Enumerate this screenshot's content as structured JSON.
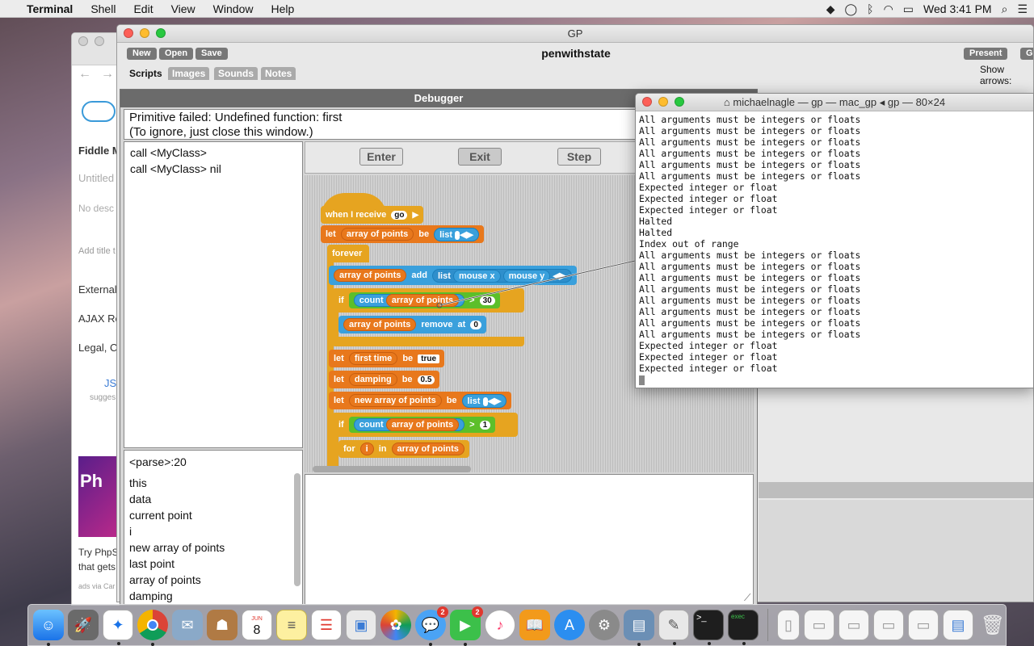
{
  "menubar": {
    "app": "Terminal",
    "items": [
      "Shell",
      "Edit",
      "View",
      "Window",
      "Help"
    ],
    "clock": "Wed 3:41 PM"
  },
  "safari": {
    "rows": [
      "Fiddle M",
      "Untitled",
      "No desc",
      "Add title t",
      "External",
      "AJAX Re",
      "Legal, Cr",
      "JS",
      "sugges",
      "Try PhpS",
      "that gets",
      "ads via Car"
    ],
    "ad_text": "Ph"
  },
  "gp": {
    "window_title": "GP",
    "project": "penwithstate",
    "buttons": {
      "new": "New",
      "open": "Open",
      "save": "Save",
      "present": "Present",
      "go": "G"
    },
    "tabs": [
      "Scripts",
      "Images",
      "Sounds",
      "Notes"
    ],
    "show_arrows": "Show arrows:"
  },
  "debugger": {
    "title": "Debugger",
    "message": [
      "Primitive failed: Undefined function: first",
      "(To ignore, just close this window.)"
    ],
    "stack": [
      "call <MyClass>",
      "call <MyClass> nil"
    ],
    "buttons": {
      "enter": "Enter",
      "exit": "Exit",
      "step": "Step"
    },
    "location": "<parse>:20",
    "vars": [
      "this",
      "data",
      "current point",
      "i",
      "new array of points",
      "last point",
      "array of points",
      "damping"
    ],
    "blocks": {
      "when_receive": "when I receive",
      "go": "go",
      "let": "let",
      "be": "be",
      "list": "list",
      "forever": "forever",
      "array_of_points": "array of points",
      "add": "add",
      "mouse_x": "mouse x",
      "mouse_y": "mouse y",
      "if": "if",
      "count": "count",
      "gt": ">",
      "thirty": "30",
      "remove": "remove",
      "at": "at",
      "zero": "0",
      "first_time": "first time",
      "true": "true",
      "damping": "damping",
      "half": "0.5",
      "new_array": "new array of points",
      "one": "1",
      "for": "for",
      "i": "i",
      "in": "in"
    }
  },
  "terminal": {
    "title": "michaelnagle — gp — mac_gp ◂ gp — 80×24",
    "lines": [
      "All arguments must be integers or floats",
      "All arguments must be integers or floats",
      "All arguments must be integers or floats",
      "All arguments must be integers or floats",
      "All arguments must be integers or floats",
      "All arguments must be integers or floats",
      "Expected integer or float",
      "Expected integer or float",
      "Expected integer or float",
      "Halted",
      "Halted",
      "Index out of range",
      "All arguments must be integers or floats",
      "All arguments must be integers or floats",
      "All arguments must be integers or floats",
      "All arguments must be integers or floats",
      "All arguments must be integers or floats",
      "All arguments must be integers or floats",
      "All arguments must be integers or floats",
      "All arguments must be integers or floats",
      "Expected integer or float",
      "Expected integer or float",
      "Expected integer or float"
    ]
  },
  "dock": {
    "calendar_month": "JUN",
    "calendar_day": "8",
    "messages_badge": "2",
    "facetime_badge": "2"
  },
  "colors": {
    "control": "#e6a420",
    "variable": "#e8781c",
    "operator": "#3aa0dc",
    "green": "#5cbf2a"
  }
}
